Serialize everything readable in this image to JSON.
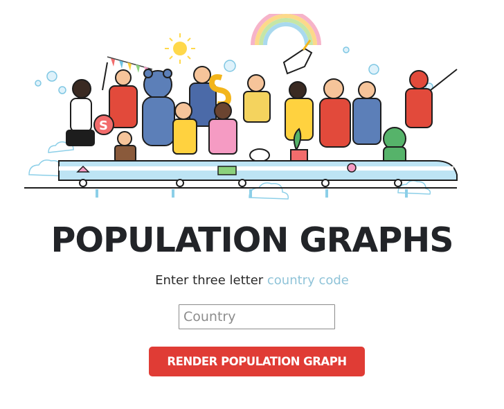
{
  "page": {
    "title": "POPULATION GRAPHS",
    "subtitle_prefix": "Enter three letter ",
    "subtitle_link": "country code"
  },
  "form": {
    "country_placeholder": "Country",
    "country_value": "",
    "submit_label": "RENDER POPULATION GRAPH"
  },
  "colors": {
    "accent_red": "#e03c35",
    "link_blue": "#8fc3d8",
    "title_dark": "#222428"
  },
  "hero": {
    "icon": "people-parade-train-illustration"
  }
}
